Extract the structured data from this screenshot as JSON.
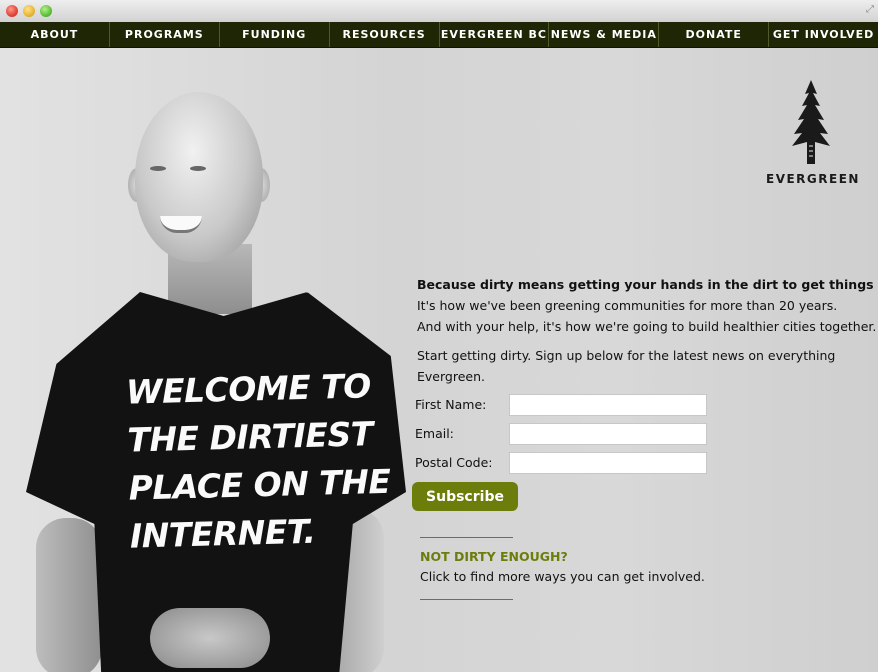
{
  "nav": {
    "items": [
      "ABOUT",
      "PROGRAMS",
      "FUNDING",
      "RESOURCES",
      "EVERGREEN BC",
      "NEWS & MEDIA",
      "DONATE",
      "GET INVOLVED"
    ]
  },
  "logo": {
    "text": "EVERGREEN"
  },
  "shirt": {
    "lines": [
      "Welcome to",
      "the dirtiest",
      "place on the",
      "internet."
    ]
  },
  "intro": {
    "lead": "Because dirty means getting your hands in the dirt to get things done.",
    "line2": "It's how we've been greening communities for more than 20 years.",
    "line3": "And with your help, it's how we're going to build healthier cities together.",
    "signup": "Start getting dirty. Sign up below for the latest news on everything Evergreen."
  },
  "form": {
    "first_name_label": "First Name:",
    "email_label": "Email:",
    "postal_label": "Postal Code:",
    "first_name_value": "",
    "email_value": "",
    "postal_value": "",
    "subscribe_label": "Subscribe"
  },
  "cta": {
    "heading": "NOT DIRTY ENOUGH?",
    "link": "Click to find more ways you can get involved."
  },
  "colors": {
    "nav_bg": "#1e2605",
    "accent": "#6c7d0b"
  }
}
